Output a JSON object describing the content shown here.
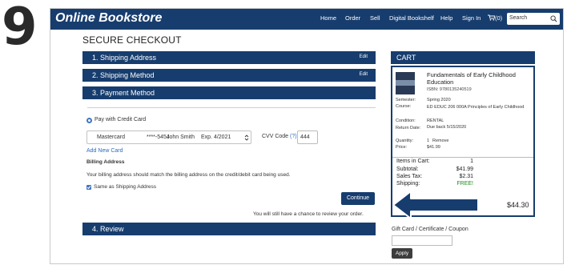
{
  "step_number": "9",
  "header": {
    "brand": "Online Bookstore",
    "nav": [
      "Home",
      "Order",
      "Sell",
      "Digital Bookshelf",
      "Help",
      "Sign In",
      "(0)"
    ],
    "search_placeholder": "Search"
  },
  "checkout": {
    "title": "SECURE CHECKOUT",
    "steps": [
      {
        "label": "1. Shipping Address",
        "action": "Edit"
      },
      {
        "label": "2. Shipping Method",
        "action": "Edit"
      },
      {
        "label": "3. Payment Method"
      },
      {
        "label": "4. Review"
      }
    ],
    "payment": {
      "option_label": "Pay with Credit Card",
      "card": {
        "brand": "Mastercard",
        "number": "****-5454",
        "name": "John Smith",
        "expiry": "Exp. 4/2021"
      },
      "cvv_label": "CVV Code",
      "cvv_help": "(?)",
      "cvv_value": "444",
      "add_card": "Add New Card",
      "billing_title": "Billing Address",
      "billing_note": "Your billing address should match the billing address on the credit/debit card being used.",
      "same_as_shipping": "Same as Shipping Address",
      "continue": "Continue",
      "review_note": "You will still have a chance to review your order."
    }
  },
  "cart": {
    "title": "CART",
    "item": {
      "title": "Fundamentals of Early Childhood Education",
      "isbn": "ISBN: 9780135240519",
      "details": [
        {
          "label": "Semester:",
          "value": "Spring 2020"
        },
        {
          "label": "Course:",
          "value": "ED EDUC 206 000A Principles of Early Childhood"
        },
        {
          "label": "Condition:",
          "value": "RENTAL"
        },
        {
          "label": "Return Date:",
          "value": "Due back 5/15/2020"
        },
        {
          "label": "Quantity:",
          "value": "1",
          "link": "Remove"
        },
        {
          "label": "Price:",
          "value": "$41.99"
        }
      ]
    },
    "items_in_cart_label": "Items in Cart:",
    "items_in_cart": "1",
    "subtotal_label": "Subtotal:",
    "subtotal": "$41.99",
    "tax_label": "Sales Tax:",
    "tax": "$2.31",
    "shipping_label": "Shipping:",
    "shipping": "FREE!",
    "total": "$44.30",
    "gift_label": "Gift Card / Certificate / Coupon",
    "apply": "Apply"
  },
  "colors": {
    "navy": "#173d6e",
    "link": "#2e6cc0",
    "free": "#1d8a1d",
    "arrow": "#173d6e"
  }
}
